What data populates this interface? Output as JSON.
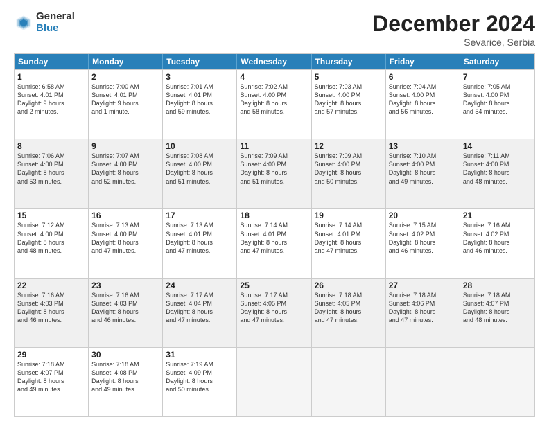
{
  "logo": {
    "general": "General",
    "blue": "Blue"
  },
  "title": "December 2024",
  "subtitle": "Sevarice, Serbia",
  "days": [
    "Sunday",
    "Monday",
    "Tuesday",
    "Wednesday",
    "Thursday",
    "Friday",
    "Saturday"
  ],
  "rows": [
    [
      {
        "day": "1",
        "text": "Sunrise: 6:58 AM\nSunset: 4:01 PM\nDaylight: 9 hours\nand 2 minutes."
      },
      {
        "day": "2",
        "text": "Sunrise: 7:00 AM\nSunset: 4:01 PM\nDaylight: 9 hours\nand 1 minute."
      },
      {
        "day": "3",
        "text": "Sunrise: 7:01 AM\nSunset: 4:01 PM\nDaylight: 8 hours\nand 59 minutes."
      },
      {
        "day": "4",
        "text": "Sunrise: 7:02 AM\nSunset: 4:00 PM\nDaylight: 8 hours\nand 58 minutes."
      },
      {
        "day": "5",
        "text": "Sunrise: 7:03 AM\nSunset: 4:00 PM\nDaylight: 8 hours\nand 57 minutes."
      },
      {
        "day": "6",
        "text": "Sunrise: 7:04 AM\nSunset: 4:00 PM\nDaylight: 8 hours\nand 56 minutes."
      },
      {
        "day": "7",
        "text": "Sunrise: 7:05 AM\nSunset: 4:00 PM\nDaylight: 8 hours\nand 54 minutes."
      }
    ],
    [
      {
        "day": "8",
        "text": "Sunrise: 7:06 AM\nSunset: 4:00 PM\nDaylight: 8 hours\nand 53 minutes."
      },
      {
        "day": "9",
        "text": "Sunrise: 7:07 AM\nSunset: 4:00 PM\nDaylight: 8 hours\nand 52 minutes."
      },
      {
        "day": "10",
        "text": "Sunrise: 7:08 AM\nSunset: 4:00 PM\nDaylight: 8 hours\nand 51 minutes."
      },
      {
        "day": "11",
        "text": "Sunrise: 7:09 AM\nSunset: 4:00 PM\nDaylight: 8 hours\nand 51 minutes."
      },
      {
        "day": "12",
        "text": "Sunrise: 7:09 AM\nSunset: 4:00 PM\nDaylight: 8 hours\nand 50 minutes."
      },
      {
        "day": "13",
        "text": "Sunrise: 7:10 AM\nSunset: 4:00 PM\nDaylight: 8 hours\nand 49 minutes."
      },
      {
        "day": "14",
        "text": "Sunrise: 7:11 AM\nSunset: 4:00 PM\nDaylight: 8 hours\nand 48 minutes."
      }
    ],
    [
      {
        "day": "15",
        "text": "Sunrise: 7:12 AM\nSunset: 4:00 PM\nDaylight: 8 hours\nand 48 minutes."
      },
      {
        "day": "16",
        "text": "Sunrise: 7:13 AM\nSunset: 4:00 PM\nDaylight: 8 hours\nand 47 minutes."
      },
      {
        "day": "17",
        "text": "Sunrise: 7:13 AM\nSunset: 4:01 PM\nDaylight: 8 hours\nand 47 minutes."
      },
      {
        "day": "18",
        "text": "Sunrise: 7:14 AM\nSunset: 4:01 PM\nDaylight: 8 hours\nand 47 minutes."
      },
      {
        "day": "19",
        "text": "Sunrise: 7:14 AM\nSunset: 4:01 PM\nDaylight: 8 hours\nand 47 minutes."
      },
      {
        "day": "20",
        "text": "Sunrise: 7:15 AM\nSunset: 4:02 PM\nDaylight: 8 hours\nand 46 minutes."
      },
      {
        "day": "21",
        "text": "Sunrise: 7:16 AM\nSunset: 4:02 PM\nDaylight: 8 hours\nand 46 minutes."
      }
    ],
    [
      {
        "day": "22",
        "text": "Sunrise: 7:16 AM\nSunset: 4:03 PM\nDaylight: 8 hours\nand 46 minutes."
      },
      {
        "day": "23",
        "text": "Sunrise: 7:16 AM\nSunset: 4:03 PM\nDaylight: 8 hours\nand 46 minutes."
      },
      {
        "day": "24",
        "text": "Sunrise: 7:17 AM\nSunset: 4:04 PM\nDaylight: 8 hours\nand 47 minutes."
      },
      {
        "day": "25",
        "text": "Sunrise: 7:17 AM\nSunset: 4:05 PM\nDaylight: 8 hours\nand 47 minutes."
      },
      {
        "day": "26",
        "text": "Sunrise: 7:18 AM\nSunset: 4:05 PM\nDaylight: 8 hours\nand 47 minutes."
      },
      {
        "day": "27",
        "text": "Sunrise: 7:18 AM\nSunset: 4:06 PM\nDaylight: 8 hours\nand 47 minutes."
      },
      {
        "day": "28",
        "text": "Sunrise: 7:18 AM\nSunset: 4:07 PM\nDaylight: 8 hours\nand 48 minutes."
      }
    ],
    [
      {
        "day": "29",
        "text": "Sunrise: 7:18 AM\nSunset: 4:07 PM\nDaylight: 8 hours\nand 49 minutes."
      },
      {
        "day": "30",
        "text": "Sunrise: 7:18 AM\nSunset: 4:08 PM\nDaylight: 8 hours\nand 49 minutes."
      },
      {
        "day": "31",
        "text": "Sunrise: 7:19 AM\nSunset: 4:09 PM\nDaylight: 8 hours\nand 50 minutes."
      },
      {
        "day": "",
        "text": ""
      },
      {
        "day": "",
        "text": ""
      },
      {
        "day": "",
        "text": ""
      },
      {
        "day": "",
        "text": ""
      }
    ]
  ]
}
